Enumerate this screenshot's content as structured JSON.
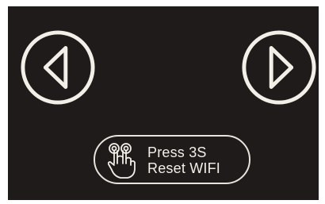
{
  "controls": {
    "prev_icon": "chevron-left-icon",
    "next_icon": "chevron-right-icon",
    "reset": {
      "icon": "double-tap-hand-icon",
      "line1": "Press 3S",
      "line2": "Reset WIFI"
    }
  },
  "colors": {
    "background": "#1f1b1a",
    "foreground": "#f2eee8"
  }
}
